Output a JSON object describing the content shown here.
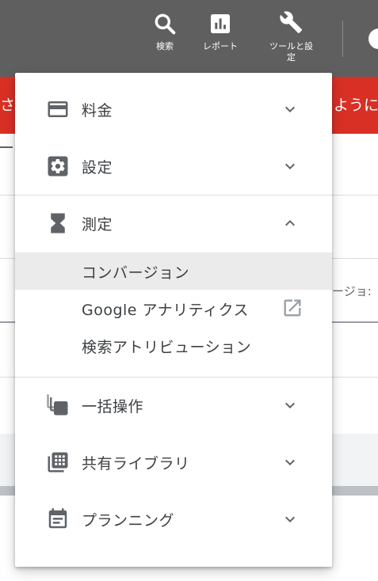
{
  "toolbar": {
    "search_label": "検索",
    "reports_label": "レポート",
    "tools_label": "ツールと設\n定"
  },
  "alert": {
    "left_text": "さ",
    "right_text": "ようにな"
  },
  "background": {
    "partial_text": "ージョ:"
  },
  "menu": {
    "billing_label": "料金",
    "settings_label": "設定",
    "measurement_label": "測定",
    "measurement_items": [
      {
        "label": "コンバージョン",
        "active": true
      },
      {
        "label": "Google アナリティクス",
        "external": true
      },
      {
        "label": "検索アトリビューション"
      }
    ],
    "bulk_actions_label": "一括操作",
    "shared_library_label": "共有ライブラリ",
    "planning_label": "プランニング"
  },
  "icons": {
    "toolbar_search": "search-icon",
    "toolbar_reports": "bar-chart-icon",
    "toolbar_tools": "wrench-icon",
    "billing": "credit-card-icon",
    "settings": "gear-icon",
    "measurement": "hourglass-icon",
    "bulk_actions": "copy-layers-icon",
    "shared_library": "library-grid-icon",
    "planning": "calendar-icon",
    "expand": "chevron-down-icon",
    "collapse": "chevron-up-icon",
    "external": "open-in-new-icon"
  },
  "colors": {
    "topbar": "#5f5f5f",
    "alert": "#d93025",
    "menu_text": "#3c4043",
    "icon": "#5f6368",
    "active_row": "#ebebeb"
  }
}
